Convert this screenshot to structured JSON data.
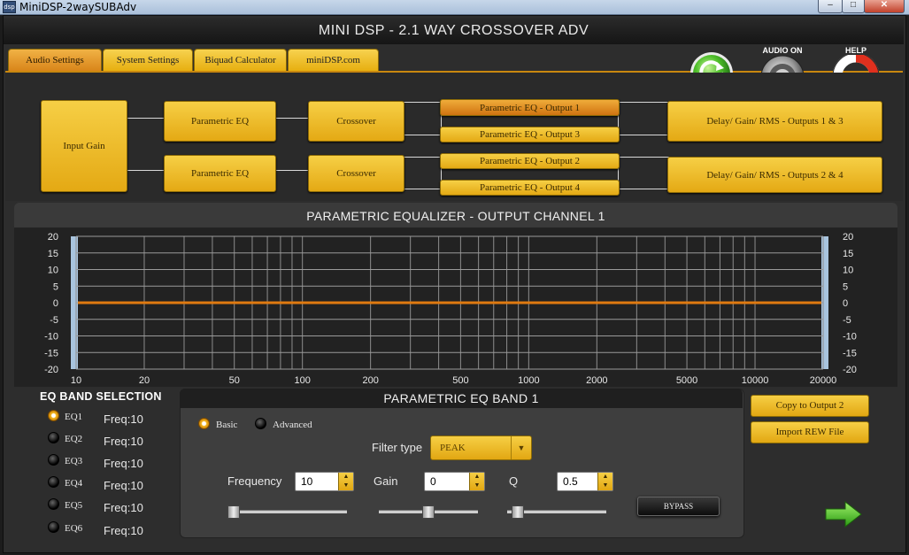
{
  "window": {
    "title": "MiniDSP-2waySUBAdv",
    "icon_text": "dsp",
    "minimize": "–",
    "maximize": "□",
    "close": "✕"
  },
  "app": {
    "title": "MINI DSP - 2.1 WAY CROSSOVER ADV"
  },
  "tabs": [
    {
      "label": "Audio Settings",
      "active": true
    },
    {
      "label": "System Settings"
    },
    {
      "label": "Biquad Calculator"
    },
    {
      "label": "miniDSP.com"
    }
  ],
  "top_icons": {
    "refresh": "refresh-icon",
    "audio_label": "AUDIO ON",
    "help_label": "HELP"
  },
  "flow": {
    "input_gain": "Input Gain",
    "peq_1": "Parametric EQ",
    "peq_2": "Parametric EQ",
    "crossover_1": "Crossover",
    "crossover_2": "Crossover",
    "out1": "Parametric EQ - Output 1",
    "out2": "Parametric EQ - Output 2",
    "out3": "Parametric EQ - Output 3",
    "out4": "Parametric EQ - Output 4",
    "delay_13": "Delay/ Gain/ RMS - Outputs 1 & 3",
    "delay_24": "Delay/ Gain/ RMS - Outputs 2 & 4"
  },
  "eq_panel": {
    "title": "PARAMETRIC EQUALIZER - OUTPUT CHANNEL 1"
  },
  "graph": {
    "y_ticks": [
      "20",
      "15",
      "10",
      "5",
      "0",
      "-5",
      "-10",
      "-15",
      "-20"
    ],
    "x_ticks": [
      {
        "label": "10",
        "v": 10
      },
      {
        "label": "20",
        "v": 20
      },
      {
        "label": "50",
        "v": 50
      },
      {
        "label": "100",
        "v": 100
      },
      {
        "label": "200",
        "v": 200
      },
      {
        "label": "500",
        "v": 500
      },
      {
        "label": "1000",
        "v": 1000
      },
      {
        "label": "2000",
        "v": 2000
      },
      {
        "label": "5000",
        "v": 5000
      },
      {
        "label": "10000",
        "v": 10000
      },
      {
        "label": "20000",
        "v": 20000
      }
    ],
    "response_gain_db": 0,
    "curve_color": "#e07a10"
  },
  "band_selection": {
    "title": "EQ BAND SELECTION",
    "bands": [
      {
        "label": "EQ1",
        "freq": "Freq:10",
        "selected": true
      },
      {
        "label": "EQ2",
        "freq": "Freq:10"
      },
      {
        "label": "EQ3",
        "freq": "Freq:10"
      },
      {
        "label": "EQ4",
        "freq": "Freq:10"
      },
      {
        "label": "EQ5",
        "freq": "Freq:10"
      },
      {
        "label": "EQ6",
        "freq": "Freq:10"
      }
    ]
  },
  "band": {
    "title": "PARAMETRIC EQ BAND 1",
    "mode_basic": "Basic",
    "mode_advanced": "Advanced",
    "mode_selected": "Basic",
    "filter_type_label": "Filter type",
    "filter_type": "PEAK",
    "frequency_label": "Frequency",
    "frequency": "10",
    "gain_label": "Gain",
    "gain": "0",
    "q_label": "Q",
    "q": "0.5",
    "bypass": "BYPASS"
  },
  "sliders": {
    "frequency_pos": 0.0,
    "gain_pos": 0.5,
    "q_pos": 0.05
  },
  "actions": {
    "copy": "Copy to Output 2",
    "import": "Import REW File",
    "next": "next-arrow-icon"
  },
  "colors": {
    "accent": "#f3c034",
    "active_tab": "#e59a28",
    "curve": "#e07a10"
  }
}
